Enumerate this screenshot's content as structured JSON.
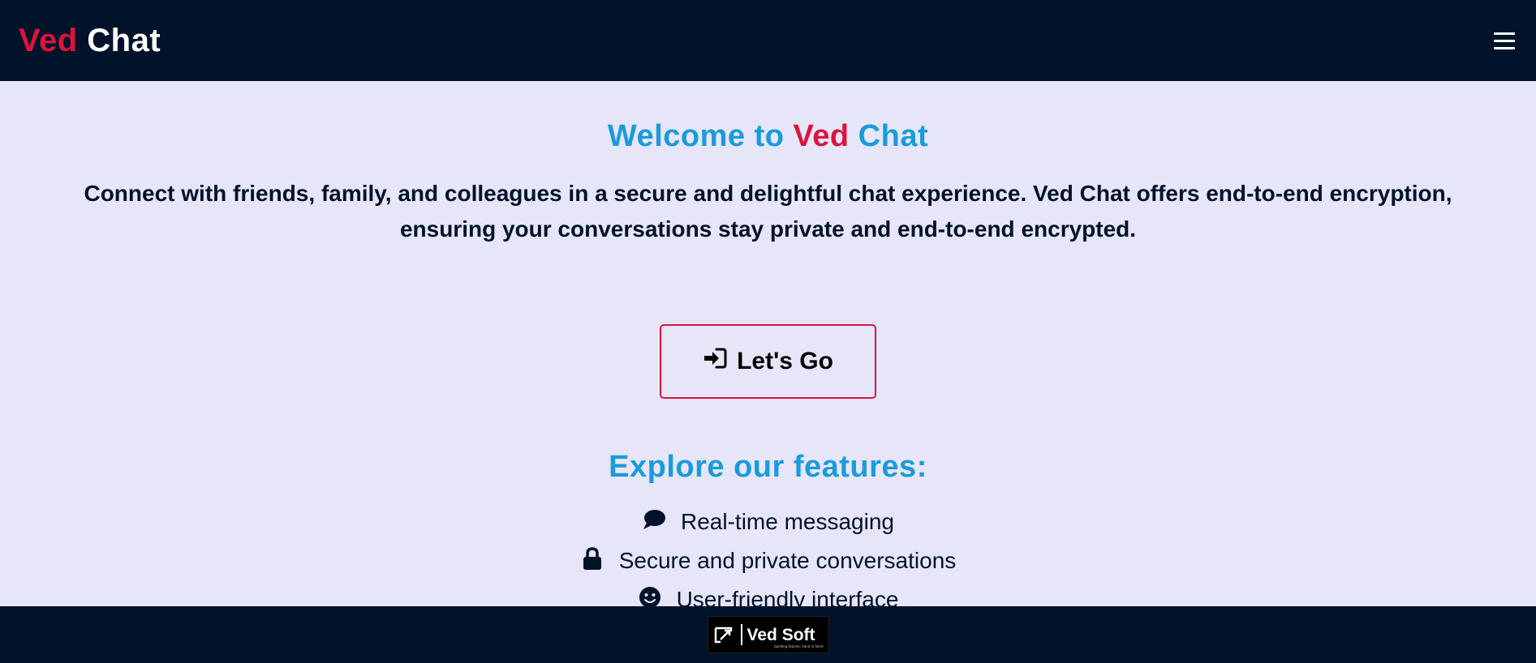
{
  "header": {
    "brand_part1": "Ved",
    "brand_part2": "Chat",
    "menu_icon": "hamburger-menu-icon"
  },
  "hero": {
    "welcome_prefix": "Welcome to",
    "welcome_accent": "Ved",
    "welcome_suffix": "Chat",
    "intro_text": "Connect with friends, family, and colleagues in a secure and delightful chat experience. Ved Chat offers end-to-end encryption, ensuring your conversations stay private and end-to-end encrypted.",
    "cta_label": "Let's Go",
    "cta_icon": "sign-in-icon"
  },
  "features": {
    "heading": "Explore our features:",
    "items": [
      {
        "icon": "chat-bubble-icon",
        "label": "Real-time messaging"
      },
      {
        "icon": "lock-icon",
        "label": "Secure and private conversations"
      },
      {
        "icon": "smiley-icon",
        "label": "User-friendly interface"
      }
    ]
  },
  "footer": {
    "logo_text": "Ved Soft",
    "logo_tagline": "building futures, hand in hand"
  },
  "colors": {
    "nav_bg": "#01122b",
    "page_bg": "#e6e6f8",
    "accent_red": "#dc143c",
    "accent_blue": "#1a9bdb"
  }
}
